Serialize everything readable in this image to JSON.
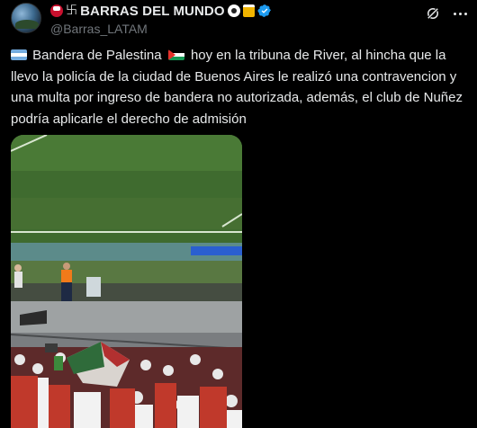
{
  "tweet": {
    "display_name": "BARRAS DEL MUNDO",
    "handle": "@Barras_LATAM",
    "verified": true,
    "text_part1": "Bandera de Palestina",
    "text_part2": "hoy en la tribuna de River, al hincha que la llevo la policía de la ciudad de Buenos Aires le realizó una contravencion y una multa por ingreso de bandera no autorizada, además, el club de Nuñez podría aplicarle el derecho de admisión",
    "icons": [
      "avatar",
      "verified-badge-icon",
      "grok-icon",
      "more-options-icon"
    ],
    "flags": [
      "argentina-flag-icon",
      "palestine-flag-icon"
    ],
    "accent_color": "#1d9bf0",
    "media": {
      "type": "video",
      "description_icon": "stadium-video-thumbnail"
    }
  }
}
